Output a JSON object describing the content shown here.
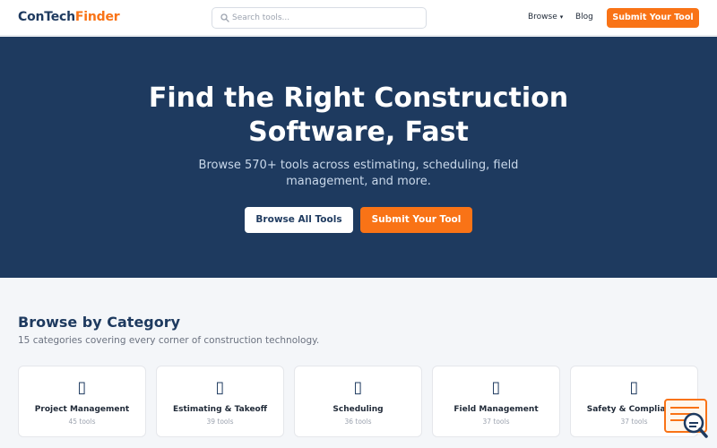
{
  "header": {
    "logo_part1": "ConTech",
    "logo_part2": "Finder",
    "search_placeholder": "Search tools...",
    "nav_browse": "Browse",
    "nav_blog": "Blog",
    "submit_button": "Submit Your Tool"
  },
  "hero": {
    "title_line1": "Find the Right Construction",
    "title_line2": "Software, Fast",
    "subtitle_line1": "Browse 570+ tools across estimating, scheduling, field",
    "subtitle_line2": "management, and more.",
    "browse_button": "Browse All Tools",
    "submit_button": "Submit Your Tool"
  },
  "categories": {
    "title": "Browse by Category",
    "subtitle": "15 categories covering every corner of construction technology.",
    "items": [
      {
        "icon": "▯",
        "name": "Project Management",
        "count": "45 tools"
      },
      {
        "icon": "▯",
        "name": "Estimating & Takeoff",
        "count": "39 tools"
      },
      {
        "icon": "▯",
        "name": "Scheduling",
        "count": "36 tools"
      },
      {
        "icon": "▯",
        "name": "Field Management",
        "count": "37 tools"
      },
      {
        "icon": "▯",
        "name": "Safety & Compliance",
        "count": "37 tools"
      }
    ]
  },
  "colors": {
    "navy": "#1e3a5f",
    "orange": "#f97316"
  }
}
